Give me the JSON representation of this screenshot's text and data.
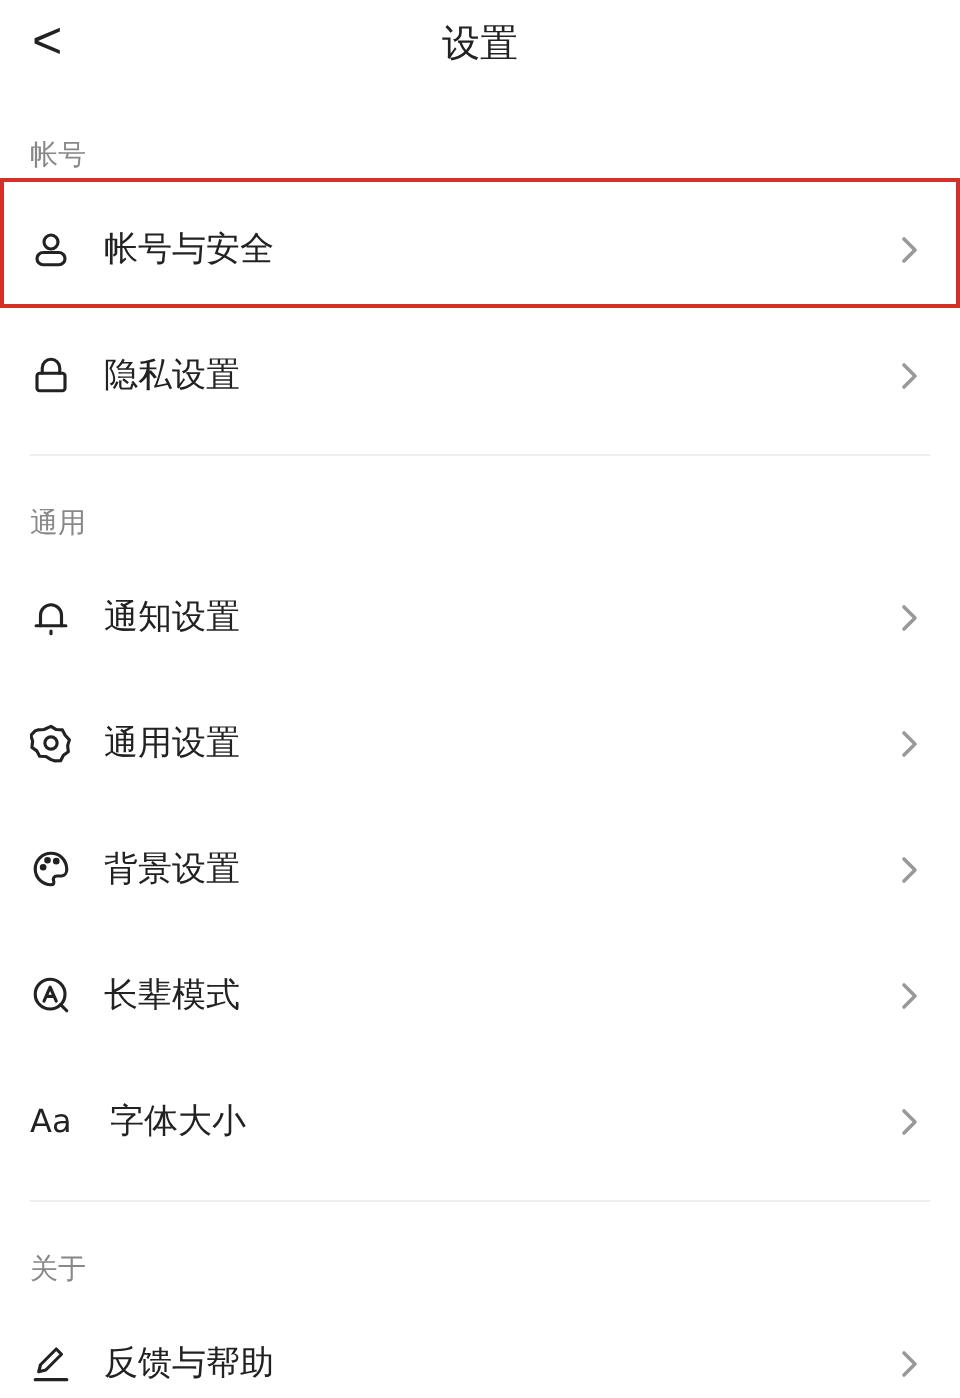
{
  "header": {
    "back": "<",
    "title": "设置"
  },
  "sections": [
    {
      "label": "帐号",
      "items": [
        {
          "kind": "person",
          "label": "帐号与安全",
          "highlighted": true
        },
        {
          "kind": "lock",
          "label": "隐私设置",
          "highlighted": false
        }
      ]
    },
    {
      "label": "通用",
      "items": [
        {
          "kind": "bell",
          "label": "通知设置",
          "highlighted": false
        },
        {
          "kind": "gear",
          "label": "通用设置",
          "highlighted": false
        },
        {
          "kind": "palette",
          "label": "背景设置",
          "highlighted": false
        },
        {
          "kind": "elder",
          "label": "长辈模式",
          "highlighted": false
        },
        {
          "kind": "text",
          "icon_text": "Aa",
          "label": "字体大小",
          "highlighted": false
        }
      ]
    },
    {
      "label": "关于",
      "items": [
        {
          "kind": "pen",
          "label": "反馈与帮助",
          "highlighted": false
        }
      ]
    }
  ]
}
